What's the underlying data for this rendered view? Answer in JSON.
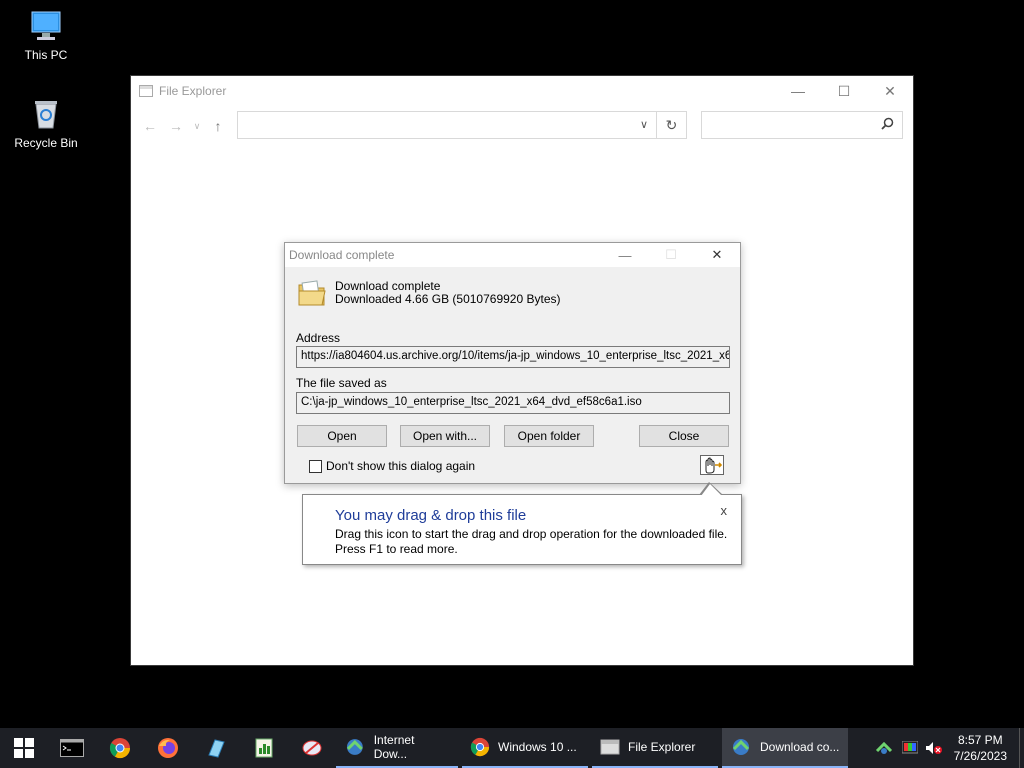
{
  "desktop": {
    "icons": [
      {
        "label": "This PC"
      },
      {
        "label": "Recycle Bin"
      }
    ]
  },
  "explorer": {
    "title": "File Explorer",
    "address_value": "",
    "search_value": ""
  },
  "dialog": {
    "title": "Download complete",
    "heading": "Download complete",
    "downloaded": "Downloaded 4.66  GB (5010769920 Bytes)",
    "address_label": "Address",
    "address_value": "https://ia804604.us.archive.org/10/items/ja-jp_windows_10_enterprise_ltsc_2021_x64_",
    "saved_label": "The file saved as",
    "saved_value": "C:\\ja-jp_windows_10_enterprise_ltsc_2021_x64_dvd_ef58c6a1.iso",
    "buttons": {
      "open": "Open",
      "open_with": "Open with...",
      "open_folder": "Open folder",
      "close": "Close"
    },
    "checkbox_label": "Don't show this dialog again",
    "checkbox_checked": false
  },
  "balloon": {
    "title": "You may drag & drop this file",
    "line1": "Drag this icon to start the drag and drop operation for the downloaded file.",
    "line2": "Press F1 to read more.",
    "close": "x"
  },
  "taskbar": {
    "tasks": [
      {
        "label": "Internet Dow..."
      },
      {
        "label": "Windows 10 ..."
      },
      {
        "label": "File Explorer"
      },
      {
        "label": "Download co..."
      }
    ],
    "time": "8:57 PM",
    "date": "7/26/2023"
  },
  "colors": {
    "balloon_title": "#1f3d99",
    "taskbar_bg": "#1d1f25",
    "active_underline": "#8ab4f8"
  }
}
